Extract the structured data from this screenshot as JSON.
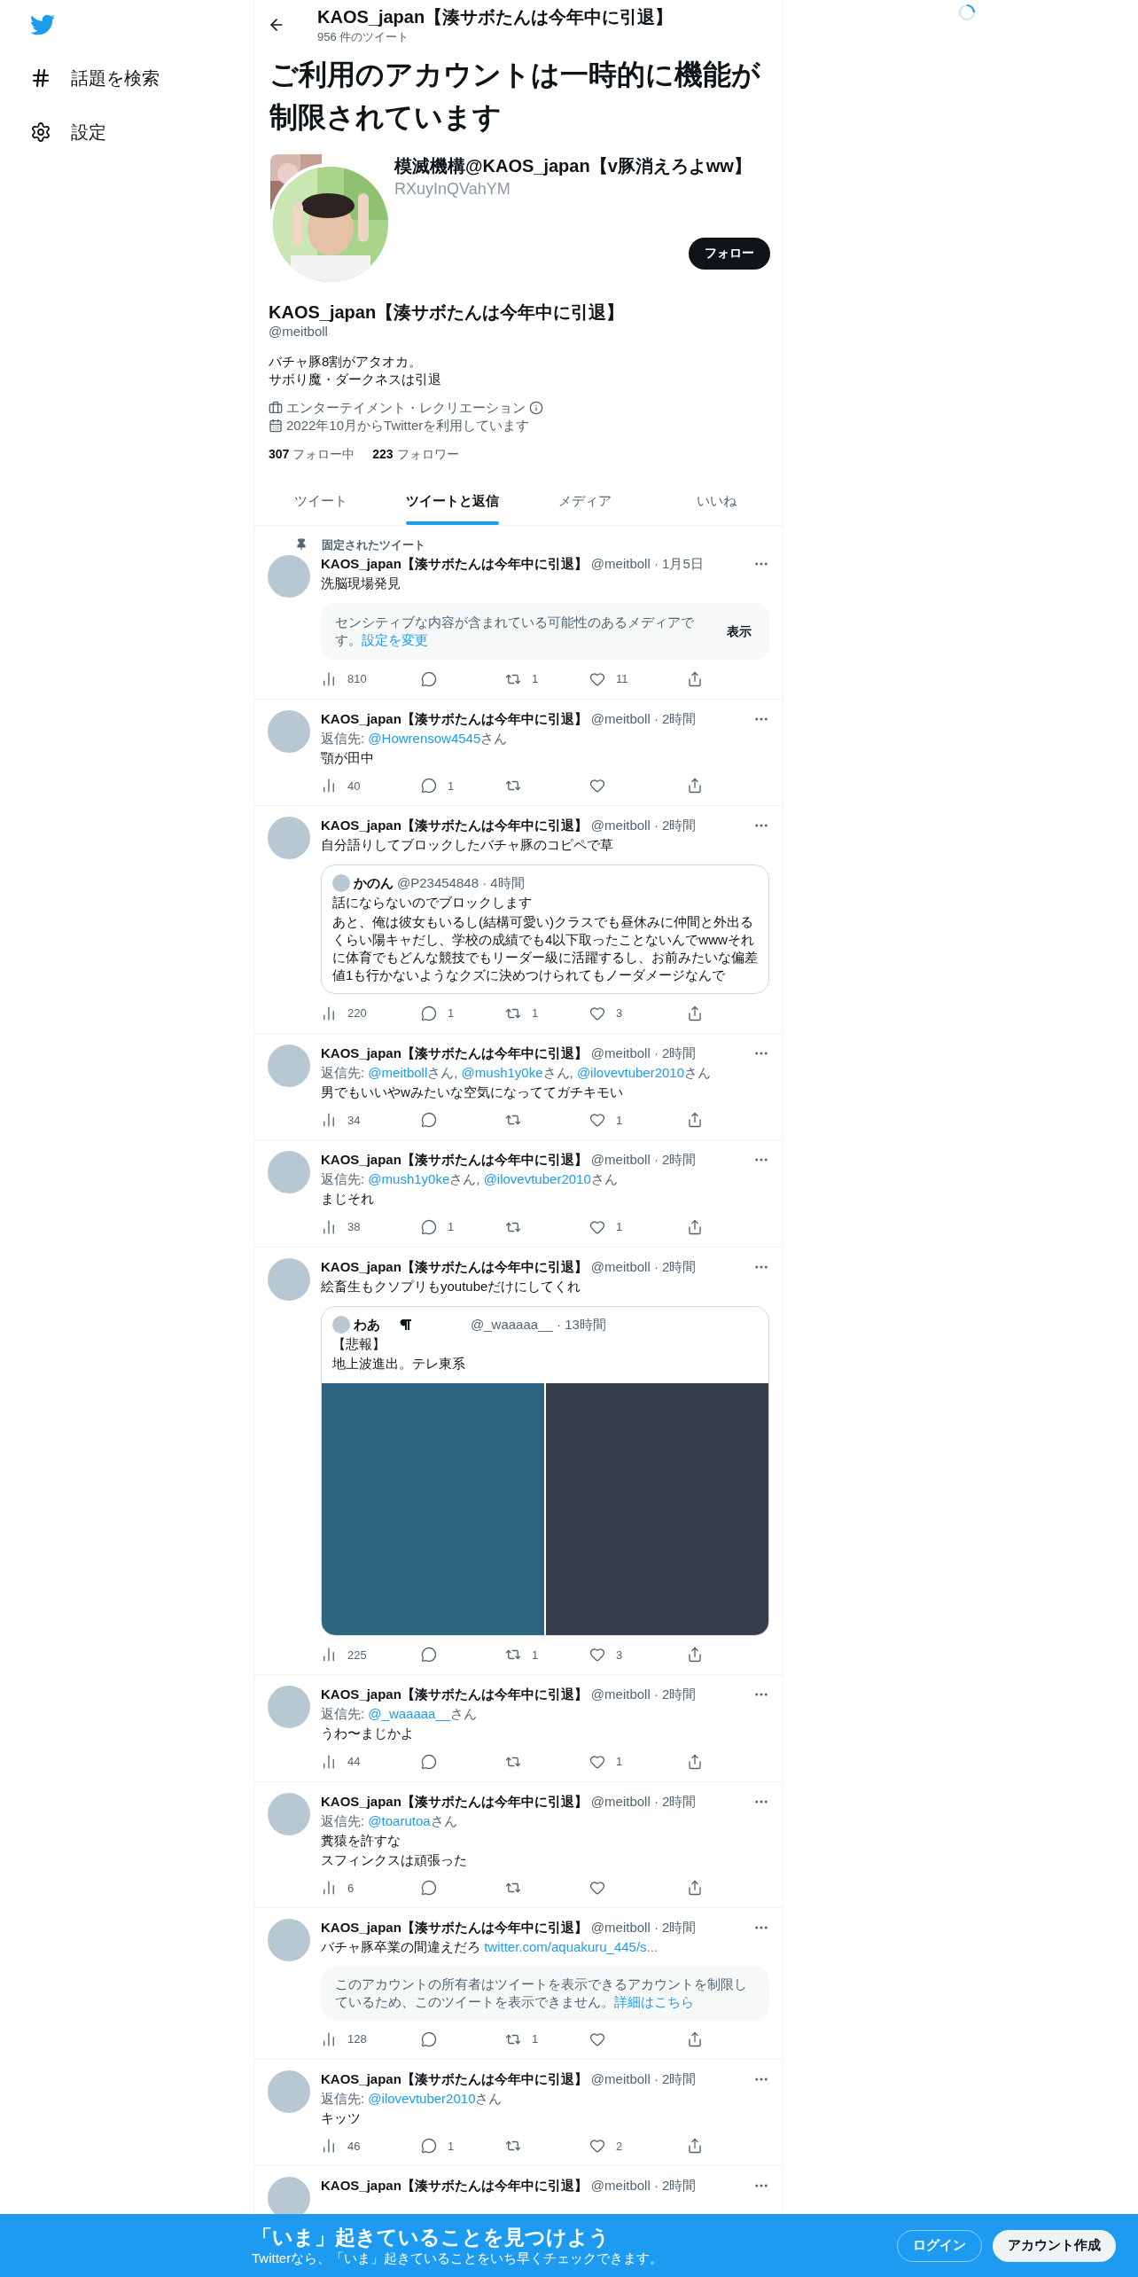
{
  "sidebar": {
    "items": [
      {
        "kind": "explore",
        "label": "話題を検索"
      },
      {
        "kind": "settings",
        "label": "設定"
      }
    ]
  },
  "header": {
    "title": "KAOS_japan【湊サボたんは今年中に引退】",
    "tweet_count": "956 件のツイート"
  },
  "notice": {
    "headline": "ご利用のアカウントは一時的に機能が制限されています"
  },
  "profile": {
    "banner_name": "模滅機構@KAOS_japan【v豚消えろよww】",
    "banner_handle": "RXuyInQVahYM",
    "follow_button": "フォロー",
    "display_name": "KAOS_japan【湊サボたんは今年中に引退】",
    "handle": "@meitboll",
    "bio": [
      "バチャ豚8割がアタオカ。",
      "サボり魔・ダークネスは引退"
    ],
    "category": "エンターテイメント・レクリエーション",
    "joined": "2022年10月からTwitterを利用しています",
    "following_count": "307",
    "following_label": "フォロー中",
    "followers_count": "223",
    "followers_label": "フォロワー"
  },
  "tabs": [
    {
      "label": "ツイート",
      "selected": false
    },
    {
      "label": "ツイートと返信",
      "selected": true
    },
    {
      "label": "メディア",
      "selected": false
    },
    {
      "label": "いいね",
      "selected": false
    }
  ],
  "tweets": [
    {
      "pinned_label": "固定されたツイート",
      "name": "KAOS_japan【湊サボたんは今年中に引退】",
      "meta": "@meitboll · 1月5日",
      "lines": [
        "洗脳現場発見"
      ],
      "media": {
        "kind": "sensitive",
        "text": "センシティブな内容が含まれている可能性のあるメディアです。",
        "link": "設定を変更",
        "button": "表示"
      },
      "stats": {
        "views": "810",
        "retweets": "1",
        "likes": "11"
      }
    },
    {
      "name": "KAOS_japan【湊サボたんは今年中に引退】",
      "meta": "@meitboll · 2時間",
      "reply_prefix": "返信先:",
      "reply_to": [
        {
          "handle": "@Howrensow4545",
          "after": "さん"
        }
      ],
      "lines": [
        "顎が田中"
      ],
      "stats": {
        "views": "40",
        "replies": "1"
      }
    },
    {
      "name": "KAOS_japan【湊サボたんは今年中に引退】",
      "meta": "@meitboll · 2時間",
      "lines": [
        "自分語りしてブロックしたバチャ豚のコピペで草"
      ],
      "media": {
        "kind": "quote",
        "name": "かのん",
        "meta": "@P23454848 · 4時間",
        "lines": [
          "話にならないのでブロックします",
          "あと、俺は彼女もいるし(結構可愛い)クラスでも昼休みに仲間と外出るくらい陽キャだし、学校の成績でも4以下取ったことないんでwwwそれに体育でもどんな競技でもリーダー級に活躍するし、お前みたいな偏差値1も行かないようなクズに決めつけられてもノーダメージなんで"
        ]
      },
      "stats": {
        "views": "220",
        "replies": "1",
        "retweets": "1",
        "likes": "3"
      }
    },
    {
      "name": "KAOS_japan【湊サボたんは今年中に引退】",
      "meta": "@meitboll · 2時間",
      "reply_prefix": "返信先:",
      "reply_to": [
        {
          "handle": "@meitboll",
          "after": "さん,"
        },
        {
          "handle": "@mush1y0ke",
          "after": "さん,"
        },
        {
          "handle": "@ilovevtuber2010",
          "after": "さん"
        }
      ],
      "lines": [
        "男でもいいやwみたいな空気になっててガチキモい"
      ],
      "stats": {
        "views": "34",
        "likes": "1"
      }
    },
    {
      "name": "KAOS_japan【湊サボたんは今年中に引退】",
      "meta": "@meitboll · 2時間",
      "reply_prefix": "返信先:",
      "reply_to": [
        {
          "handle": "@mush1y0ke",
          "after": "さん,"
        },
        {
          "handle": "@ilovevtuber2010",
          "after": "さん"
        }
      ],
      "lines": [
        "まじそれ"
      ],
      "stats": {
        "views": "38",
        "replies": "1",
        "likes": "1"
      }
    },
    {
      "name": "KAOS_japan【湊サボたんは今年中に引退】",
      "meta": "@meitboll · 2時間",
      "lines": [
        "絵畜生もクソプリもyoutubeだけにしてくれ"
      ],
      "media": {
        "kind": "quote",
        "name": "わあ",
        "name_emoji": true,
        "meta": "@_waaaaa__ · 13時間",
        "lines": [
          "【悲報】",
          "地上波進出。テレ東系"
        ],
        "images": [
          {
            "kind": "picture"
          },
          {
            "kind": "picture"
          }
        ]
      },
      "stats": {
        "views": "225",
        "retweets": "1",
        "likes": "3"
      }
    },
    {
      "name": "KAOS_japan【湊サボたんは今年中に引退】",
      "meta": "@meitboll · 2時間",
      "reply_prefix": "返信先:",
      "reply_to": [
        {
          "handle": "@_waaaaa__",
          "after": "さん"
        }
      ],
      "lines": [
        "うわ〜まじかよ"
      ],
      "stats": {
        "views": "44",
        "likes": "1"
      }
    },
    {
      "name": "KAOS_japan【湊サボたんは今年中に引退】",
      "meta": "@meitboll · 2時間",
      "reply_prefix": "返信先:",
      "reply_to": [
        {
          "handle": "@toarutoa",
          "after": "さん"
        }
      ],
      "lines": [
        "糞猿を許すな",
        "スフィンクスは頑張った"
      ],
      "stats": {
        "views": "6"
      }
    },
    {
      "name": "KAOS_japan【湊サボたんは今年中に引退】",
      "meta": "@meitboll · 2時間",
      "lines": [
        "バチャ豚卒業の間違えだろ"
      ],
      "link": "twitter.com/aquakuru_445/s...",
      "media": {
        "kind": "restricted",
        "text": "このアカウントの所有者はツイートを表示できるアカウントを制限しているため、このツイートを表示できません。",
        "link": "詳細はこちら"
      },
      "stats": {
        "views": "128",
        "retweets": "1"
      }
    },
    {
      "name": "KAOS_japan【湊サボたんは今年中に引退】",
      "meta": "@meitboll · 2時間",
      "reply_prefix": "返信先:",
      "reply_to": [
        {
          "handle": "@ilovevtuber2010",
          "after": "さん"
        }
      ],
      "lines": [
        "キッツ"
      ],
      "stats": {
        "views": "46",
        "replies": "1",
        "likes": "2"
      }
    },
    {
      "name": "KAOS_japan【湊サボたんは今年中に引退】",
      "meta": "@meitboll · 2時間"
    }
  ],
  "bottom_banner": {
    "title": "「いま」起きていることを見つけよう",
    "subtitle": "Twitterなら、「いま」起きていることをいち早くチェックできます。",
    "login": "ログイン",
    "signup": "アカウント作成"
  }
}
